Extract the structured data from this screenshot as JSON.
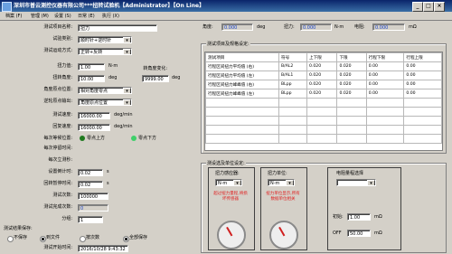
{
  "window": {
    "title": "深圳市普云测控仪器有限公司***扭转试验机【Administrator】【On Line】",
    "min_glyph": "_",
    "max_glyph": "□",
    "close_glyph": "×"
  },
  "menu": [
    "档案 (F)",
    "管理 (M)",
    "设置 (S)",
    "日常 (E)",
    "执行 (X)"
  ],
  "form": {
    "fields": [
      {
        "label": "测试项目名称:",
        "value": "扭力",
        "unit": ""
      },
      {
        "label": "试验类别:",
        "value": "顺时针+逆时针",
        "unit": ""
      },
      {
        "label": "测试运动方式:",
        "value": "正转+反转",
        "unit": ""
      },
      {
        "label": "扭力值:",
        "value": "1.00",
        "unit": "N·m"
      },
      {
        "label": "扭转角度:",
        "value": "10.00",
        "unit": "deg"
      },
      {
        "label": "角度原点位置:",
        "value": "相对角度零点",
        "unit": ""
      },
      {
        "label": "逆轮原点输出:",
        "value": "角度原点位置",
        "unit": ""
      },
      {
        "label": "测试速度:",
        "value": "16000.00",
        "unit": "deg/min"
      },
      {
        "label": "回复速度:",
        "value": "16000.00",
        "unit": "deg/min"
      },
      {
        "label": "每次等候位置:",
        "value": "零点上方",
        "unit": ""
      },
      {
        "label": "每次停留时间:",
        "value": "",
        "unit": ""
      },
      {
        "label": "每次立测秒:",
        "value": "",
        "unit": ""
      },
      {
        "label": "设置倒计时:",
        "value": "0.02",
        "unit": "s"
      },
      {
        "label": "回转暂停时间:",
        "value": "0.02",
        "unit": "s"
      },
      {
        "label": "测试次数:",
        "value": "100000",
        "unit": ""
      },
      {
        "label": "测试完成次数:",
        "value": "0",
        "unit": ""
      },
      {
        "label": "分组:",
        "value": "1",
        "unit": ""
      }
    ],
    "angle_limit_label": "转角度变化:",
    "angle_limit_value": "9999.00",
    "angle_limit_unit": "deg",
    "pos_up": "零点上方",
    "pos_down": "零点下方",
    "radio_section_label": "测试结果保存:",
    "radio_options": [
      "不保存",
      "到文件",
      "按次数",
      "全部保存"
    ],
    "start_time_label": "测试开始时间:",
    "start_time_value": "2016/10/28 9:43:32"
  },
  "readouts": {
    "angle": {
      "label": "角度:",
      "value": "0.000",
      "unit": "deg"
    },
    "torque": {
      "label": "扭力:",
      "value": "0.000",
      "unit": "N·m"
    },
    "voltage": {
      "label": "电阻:",
      "value": "0.000",
      "unit": "mΩ"
    }
  },
  "spec_table": {
    "title": "测试项目及规格设定:",
    "headers": [
      "测试项目",
      "符号",
      "上下限",
      "下限",
      "行程下限",
      "行程上限"
    ],
    "rows": [
      [
        "行程区间扭力平均值 (右)",
        "B/AL2",
        "0.020",
        "0.020",
        "0.00",
        "0.00"
      ],
      [
        "行程区间扭力平均值 (左)",
        "B/AL1",
        "0.020",
        "0.020",
        "0.00",
        "0.00"
      ],
      [
        "行程区间扭力峰峰值 (右)",
        "BLpp",
        "0.020",
        "0.020",
        "0.00",
        "0.00"
      ],
      [
        "行程区间扭力峰峰值 (左)",
        "BLpp",
        "0.020",
        "0.020",
        "0.00",
        "0.00"
      ]
    ]
  },
  "sensor": {
    "title": "测设选及单位设定:",
    "torque_sensor": {
      "label": "扭力感应器:",
      "unit": "N·m",
      "warning": "超过扭力量程,将损坏传感器"
    },
    "torque_unit": {
      "label": "扭力单位:",
      "unit": "N·m",
      "warning": "扭力单位显示,所有数据单位相关"
    },
    "resistance": {
      "label": "电阻量程选择",
      "unit": "",
      "field1_label": "初始:",
      "field1_value": "1.00",
      "field1_unit": "mΩ",
      "field2_label": "OFF",
      "field2_value": "50.00",
      "field2_unit": "mΩ"
    }
  },
  "colors": {
    "accent": "#0a246a",
    "warning_text": "#e02020",
    "readout_text": "#1a44c8"
  }
}
